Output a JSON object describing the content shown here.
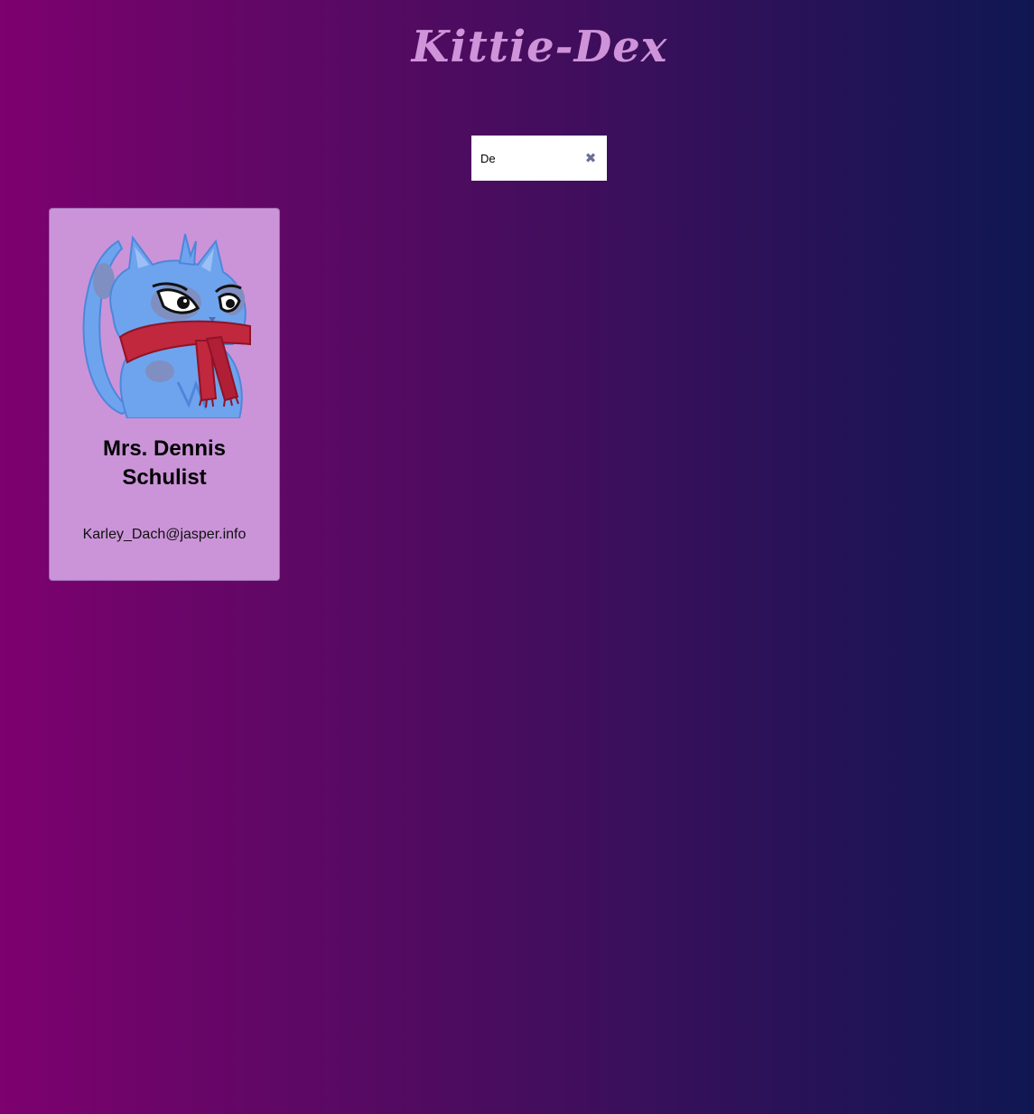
{
  "header": {
    "title": "Kittie-Dex"
  },
  "search": {
    "value": "De",
    "placeholder": "",
    "clear_icon": "close-icon"
  },
  "cards": [
    {
      "name": "Mrs. Dennis Schulist",
      "email": "Karley_Dach@jasper.info",
      "avatar_icon": "blue-cat-with-red-scarf"
    }
  ],
  "colors": {
    "gradient_start": "#7d016f",
    "gradient_end": "#0f1752",
    "title": "#cf93d9",
    "card_background": "#cb94d8"
  }
}
